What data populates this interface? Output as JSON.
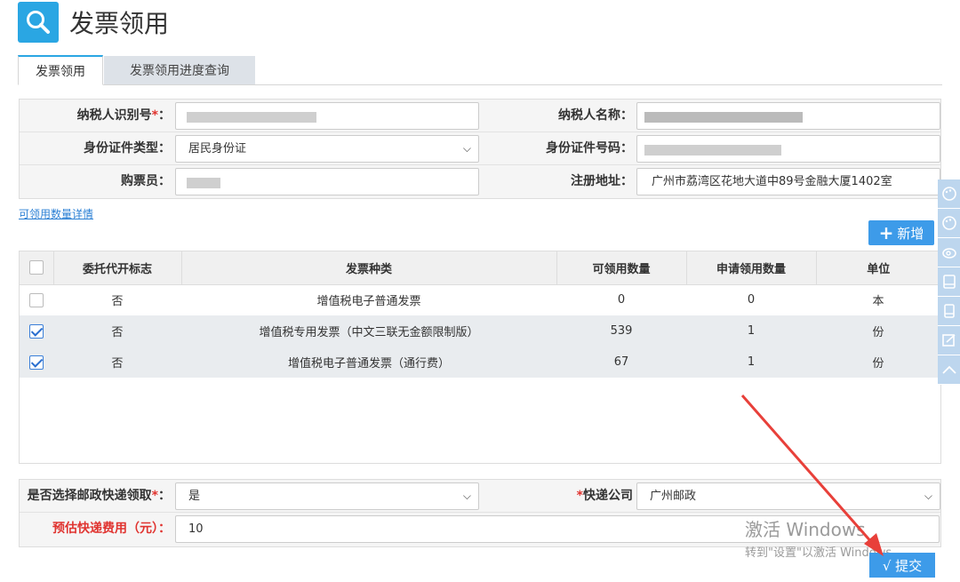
{
  "header": {
    "title": "发票领用",
    "icon": "search-icon"
  },
  "tabs": [
    {
      "label": "发票领用",
      "active": true
    },
    {
      "label": "发票领用进度查询",
      "active": false
    }
  ],
  "taxpayer": {
    "id_label": "纳税人识别号",
    "name_label": "纳税人名称：",
    "idtype_label": "身份证件类型：",
    "idtype_value": "居民身份证",
    "idnum_label": "身份证件号码：",
    "buyer_label": "购票员：",
    "address_label": "注册地址：",
    "address_value": "广州市荔湾区花地大道中89号金融大厦1402室"
  },
  "detail_link": "可领用数量详情",
  "add_button": "新增",
  "grid": {
    "columns": [
      "委托代开标志",
      "发票种类",
      "可领用数量",
      "申请领用数量",
      "单位"
    ],
    "rows": [
      {
        "checked": false,
        "flag": "否",
        "type": "增值税电子普通发票",
        "avail": "0",
        "apply": "0",
        "unit": "本"
      },
      {
        "checked": true,
        "flag": "否",
        "type": "增值税专用发票（中文三联无金额限制版）",
        "avail": "539",
        "apply": "1",
        "unit": "份"
      },
      {
        "checked": true,
        "flag": "否",
        "type": "增值税电子普通发票（通行费）",
        "avail": "67",
        "apply": "1",
        "unit": "份"
      }
    ]
  },
  "mail": {
    "post_label": "是否选择邮政快递领取",
    "post_value": "是",
    "courier_label": "快递公司",
    "courier_value": "广州邮政",
    "fee_label": "预估快递费用（元）：",
    "fee_value": "10"
  },
  "submit_button": "√ 提交",
  "watermark": {
    "line1": "激活 Windows",
    "line2": "转到\"设置\"以激活 Windows。"
  },
  "colors": {
    "accent": "#3d9be9",
    "brand": "#2aa6e3",
    "required": "#e0332f",
    "annotation": "#e8403a"
  }
}
